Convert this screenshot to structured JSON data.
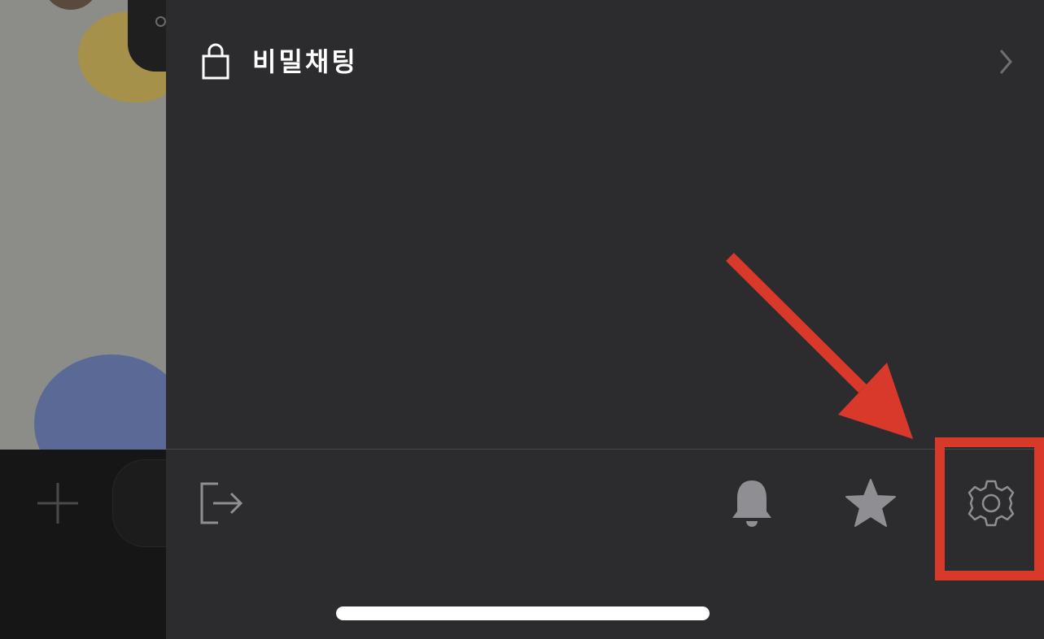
{
  "menu": {
    "secret_chat_label": "비밀채팅",
    "lock_icon": "lock-icon",
    "chevron_icon": "chevron-right-icon"
  },
  "toolbar": {
    "exit_icon": "exit-icon",
    "bell_icon": "bell-icon",
    "star_icon": "star-icon",
    "settings_icon": "gear-icon"
  },
  "annotation": {
    "color": "#d8392a",
    "target": "settings"
  },
  "colors": {
    "drawer_bg": "#2c2c2e",
    "icon_gray": "#8e8e93",
    "text": "#ffffff"
  }
}
